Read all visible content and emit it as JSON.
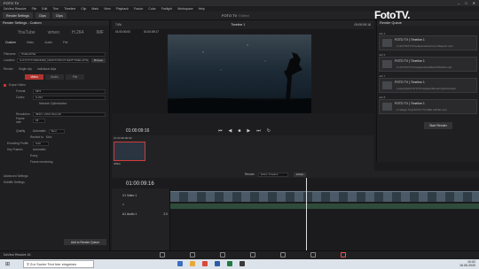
{
  "window": {
    "title": "FOTO TV"
  },
  "menu": [
    "DaVinci Resolve",
    "File",
    "Edit",
    "Trim",
    "Timeline",
    "Clip",
    "Mark",
    "View",
    "Playback",
    "Fusion",
    "Color",
    "Fairlight",
    "Workspace",
    "Help"
  ],
  "toolbar": {
    "render_settings": "Render Settings",
    "clips": "Clips",
    "clips2": "Clips"
  },
  "project_title": "FOTO TV",
  "project_state": "Edited",
  "logo": "FotoTV.",
  "render_settings": {
    "header": "Render Settings - Custom",
    "formats": [
      "YouTube",
      "vimeo",
      "H.264",
      "IMF"
    ],
    "tabs": [
      "Custom",
      "Video",
      "Audio",
      "File"
    ],
    "filename_label": "Filename",
    "filename_value": "TIMELAPSE",
    "location_label": "Location",
    "location_value": "E:\\FOTOTV\\RENDER_DESKTOP\\OUT\\EDIT\\TIMELAPSE",
    "browse": "Browse",
    "render_label": "Render",
    "single_clip": "Single clip",
    "individual_clips": "Individual clips",
    "toggle_tabs": [
      "Video",
      "Audio",
      "File"
    ],
    "export_video": "Export Video",
    "format_label": "Format",
    "format_value": "MP4",
    "codec_label": "Codec",
    "codec_value": "H.264",
    "network": "Network Optimization",
    "resolution_label": "Resolution",
    "resolution_value": "3840 x 2160 Ultra HD",
    "framerate_label": "Frame rate",
    "framerate_value": "25",
    "quality_label": "Quality",
    "quality_auto": "Automatic",
    "quality_best": "Best",
    "restrict": "Restrict to",
    "restrict_unit": "Kb/s",
    "encoding_label": "Encoding Profile",
    "encoding_value": "Auto",
    "keyframes_label": "Key Frames",
    "keyframes_auto": "Automatic",
    "every": "Every",
    "frame_reordering": "Frame reordering",
    "advanced": "Advanced Settings",
    "subtitle": "Subtitle Settings",
    "add_queue": "Add to Render Queue"
  },
  "viewer": {
    "zoom": "74%",
    "src_tc": "01:00:00:00",
    "timecode": "01:00:09:17",
    "timeline": "Timeline 1",
    "right_tc": "00:00:09:16",
    "tc2": "01:00:09:16"
  },
  "clip": {
    "label": "V1",
    "tc": "01:00:00:00",
    "name": "JPEG"
  },
  "queue": {
    "header": "Render Queue",
    "render_all": "Start Render",
    "jobs": [
      {
        "id": "Job 4",
        "title": "FOTO TV | Timeline 1",
        "path": "...G:\\FOTO\\TV\\Timelapse\\www.foto.tv.Rapport.mp4"
      },
      {
        "id": "Job 5",
        "title": "FOTO TV | Timeline 1",
        "path": "...G:\\FOTO\\TV\\Timelapse\\foto\\NEU\\UPDATE.mp4"
      },
      {
        "id": "Job 7",
        "title": "FOTO TV | Timeline 1",
        "path": "...\\videoclip\\FOTOTV\\Timelapse\\Rendering\\Download"
      },
      {
        "id": "Job 8",
        "title": "FOTO TV | Timeline 1",
        "path": "...G:\\Magic Trips\\FOTO TV\\TIME LAPSE.mp4"
      }
    ]
  },
  "timeline": {
    "tc": "01:00:09:16",
    "render_label": "Render",
    "render_value": "Entire Timeline",
    "in_out": "In/Out",
    "tracks": [
      {
        "id": "V1",
        "name": "Video 1"
      },
      {
        "id": "A1",
        "name": "Audio 1",
        "level": "2.0"
      }
    ]
  },
  "app_footer": "DaVinci Resolve 16",
  "taskbar": {
    "search_placeholder": "Zur Suche Text hier eingeben",
    "time": "10:02",
    "date": "16.06.2020",
    "lang": "DEU"
  }
}
